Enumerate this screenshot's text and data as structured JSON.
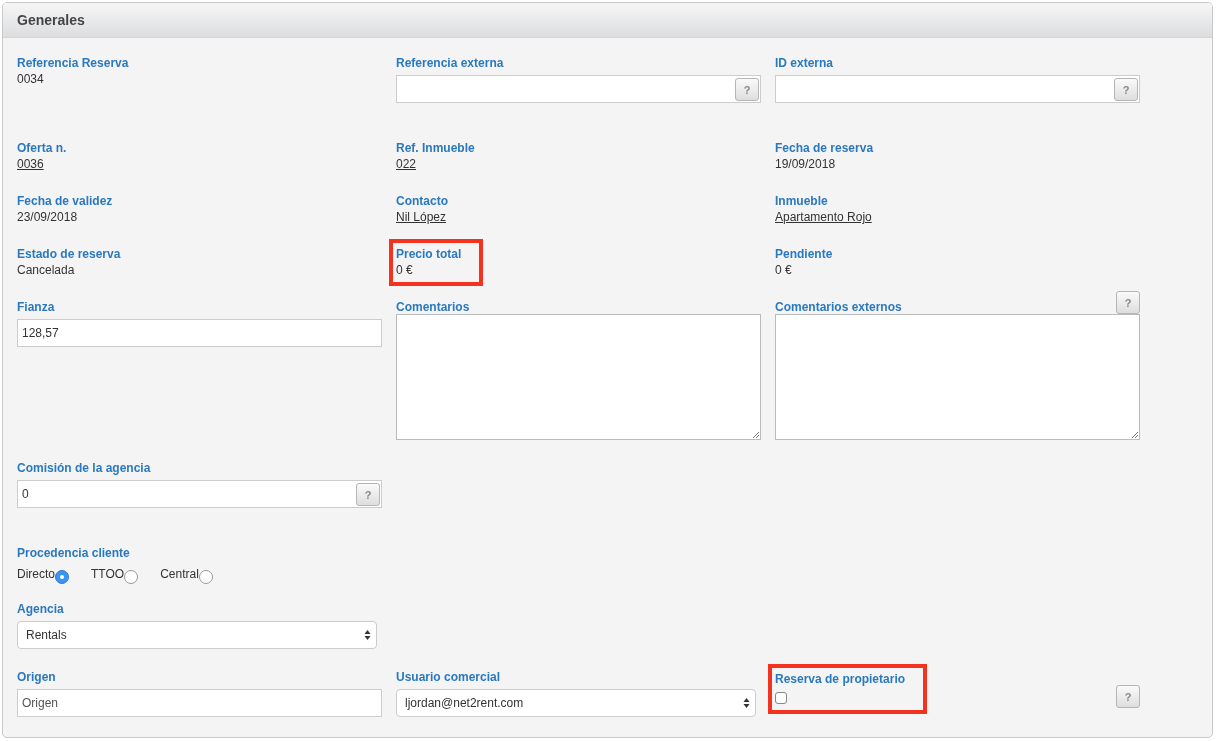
{
  "panel": {
    "title": "Generales"
  },
  "rows": [
    [
      {
        "kind": "text",
        "label": "Referencia Reserva",
        "value": "0034"
      },
      {
        "kind": "input",
        "label": "Referencia externa",
        "help": "?"
      },
      {
        "kind": "input",
        "label": "ID externa",
        "help": "?"
      }
    ],
    [
      {
        "kind": "link",
        "label": "Oferta n.",
        "value": "0036"
      },
      {
        "kind": "link",
        "label": "Ref. Inmueble",
        "value": "022"
      },
      {
        "kind": "text",
        "label": "Fecha de reserva",
        "value": "19/09/2018"
      }
    ],
    [
      {
        "kind": "text",
        "label": "Fecha de validez",
        "value": "23/09/2018"
      },
      {
        "kind": "link",
        "label": "Contacto",
        "value": "Nil López"
      },
      {
        "kind": "link",
        "label": "Inmueble",
        "value": "Apartamento Rojo"
      }
    ],
    [
      {
        "kind": "text",
        "label": "Estado de reserva",
        "value": "Cancelada"
      },
      {
        "kind": "text",
        "label": "Precio total",
        "value": "0 €",
        "highlighted": true
      },
      {
        "kind": "text",
        "label": "Pendiente",
        "value": "0 €"
      }
    ],
    [
      {
        "kind": "input",
        "label": "Fianza",
        "value": "128,57"
      },
      {
        "kind": "textarea",
        "label": "Comentarios"
      },
      {
        "kind": "textarea",
        "label": "Comentarios externos",
        "help": "?"
      }
    ],
    [
      {
        "kind": "input",
        "label": "Comisión de la agencia",
        "value": "0",
        "help": "?"
      }
    ],
    [
      {
        "kind": "radio",
        "label": "Procedencia cliente",
        "options": [
          {
            "label": "Directo",
            "selected": true
          },
          {
            "label": "TTOO",
            "selected": false
          },
          {
            "label": "Central",
            "selected": false
          }
        ]
      }
    ],
    [
      {
        "kind": "select",
        "label": "Agencia",
        "value": "Rentals"
      }
    ],
    [
      {
        "kind": "input",
        "label": "Origen",
        "placeholder": "Origen"
      },
      {
        "kind": "select",
        "label": "Usuario comercial",
        "value": "ljordan@net2rent.com"
      },
      {
        "kind": "checkbox",
        "label": "Reserva de propietario",
        "checked": false,
        "highlighted": true,
        "help": "?"
      }
    ]
  ]
}
